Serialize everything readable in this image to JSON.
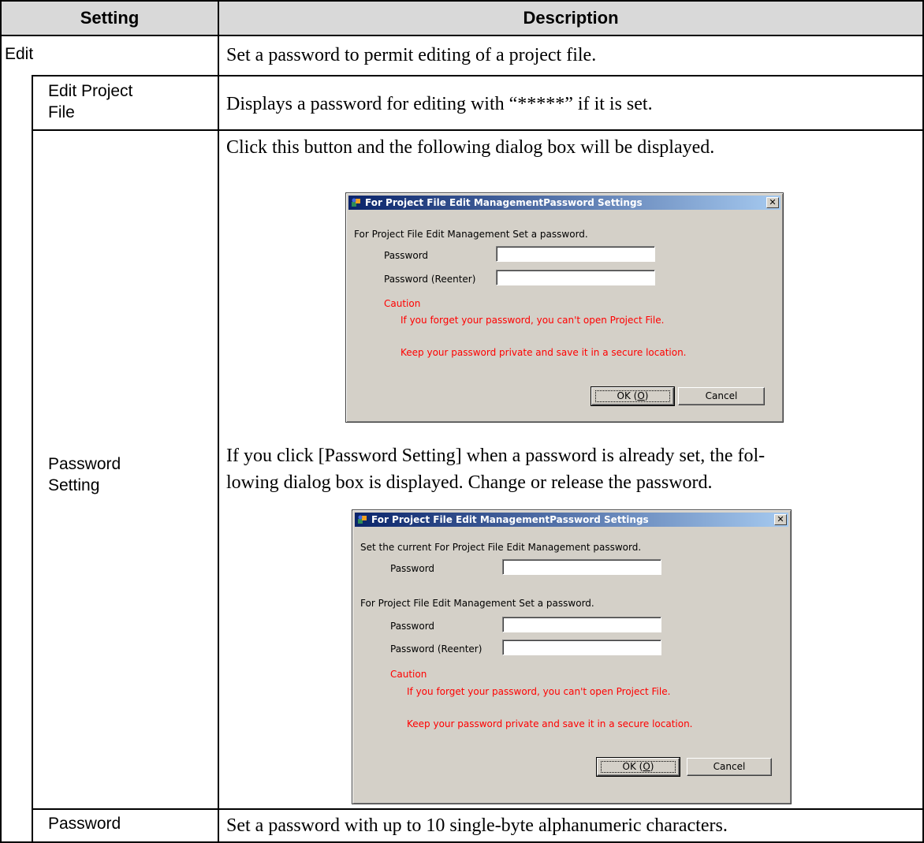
{
  "table": {
    "header_setting": "Setting",
    "header_description": "Description",
    "rows": [
      {
        "setting": "Edit",
        "description": "Set a password to permit editing of a project file."
      },
      {
        "setting_line1": "Edit Project",
        "setting_line2": "File",
        "description": "Displays a password for editing with “*****” if it is set."
      },
      {
        "setting_line1": "Password",
        "setting_line2": "Setting",
        "description_intro": "Click this button and the following dialog box will be displayed.",
        "description_mid_line1": "If you click [Password Setting] when a password is already set, the fol-",
        "description_mid_line2": "lowing dialog box is displayed. Change or release the password."
      },
      {
        "setting": "Password",
        "description": "Set a password with up to 10 single-byte alphanumeric characters."
      }
    ]
  },
  "dialog1": {
    "title": "For Project File Edit ManagementPassword Settings",
    "close_glyph": "✕",
    "prompt": "For Project File Edit Management Set a password.",
    "password_label": "Password",
    "password_reenter_label": "Password (Reenter)",
    "password_value": "",
    "password_reenter_value": "",
    "caution_label": "Caution",
    "caution_line1": "If you forget your password, you can't open Project File.",
    "caution_line2": "Keep your password private and save it in a secure location.",
    "ok_label": "OK (",
    "ok_mnemonic": "O",
    "ok_label_end": ")",
    "cancel_label": "Cancel"
  },
  "dialog2": {
    "title": "For Project File Edit ManagementPassword Settings",
    "close_glyph": "✕",
    "current_prompt": "Set the current For Project File Edit Management password.",
    "current_password_label": "Password",
    "prompt": "For Project File Edit Management Set a password.",
    "password_label": "Password",
    "password_reenter_label": "Password (Reenter)",
    "current_password_value": "",
    "password_value": "",
    "password_reenter_value": "",
    "caution_label": "Caution",
    "caution_line1": "If you forget your password, you can't open Project File.",
    "caution_line2": "Keep your password private and save it in a secure location.",
    "ok_label": "OK (",
    "ok_mnemonic": "O",
    "ok_label_end": ")",
    "cancel_label": "Cancel"
  },
  "colors": {
    "header_bg": "#d9d9d9",
    "dialog_bg": "#d4d0c8",
    "titlebar_start": "#0a246a",
    "titlebar_end": "#a6caf0",
    "caution_text": "#ff0000"
  },
  "icons": {
    "dialog_app_icon": "project-tool-icon",
    "dialog_close_icon": "close-icon"
  }
}
